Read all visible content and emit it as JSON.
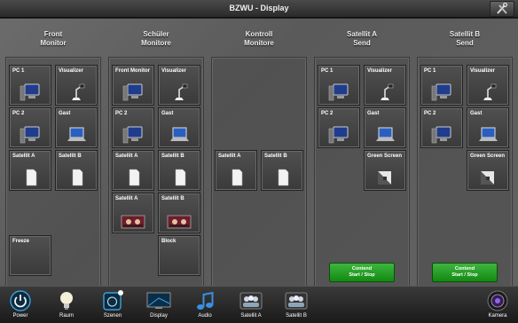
{
  "window": {
    "title": "BZWU - Display"
  },
  "columns": [
    {
      "title_line1": "Front",
      "title_line2": "Monitor"
    },
    {
      "title_line1": "Schüler",
      "title_line2": "Monitore"
    },
    {
      "title_line1": "Kontroll",
      "title_line2": "Monitore"
    },
    {
      "title_line1": "Satellit A",
      "title_line2": "Send"
    },
    {
      "title_line1": "Satellit B",
      "title_line2": "Send"
    }
  ],
  "tiles": {
    "pc1": "PC 1",
    "visualizer": "Visualizer",
    "pc2": "PC 2",
    "gast": "Gast",
    "satellit_a": "Satellit A",
    "satellit_b": "Satellit B",
    "freeze": "Freeze",
    "front_monitor": "Front Monitor",
    "block": "Block",
    "green_screen": "Green Screen"
  },
  "buttons": {
    "contend_line1": "Contend",
    "contend_line2": "Start / Stop"
  },
  "nav": [
    {
      "label": "Power",
      "icon": "power-icon"
    },
    {
      "label": "Raum",
      "icon": "lightbulb-icon"
    },
    {
      "label": "Szenen",
      "icon": "scenes-icon"
    },
    {
      "label": "Display",
      "icon": "display-icon"
    },
    {
      "label": "Audio",
      "icon": "music-note-icon"
    },
    {
      "label": "Satellit A",
      "icon": "group-icon"
    },
    {
      "label": "Satellit B",
      "icon": "group-icon"
    },
    {
      "label": "Kamera",
      "icon": "camera-icon"
    }
  ],
  "colors": {
    "accent_green": "#1e9a1e",
    "nav_accent": "#3aa0e0"
  }
}
